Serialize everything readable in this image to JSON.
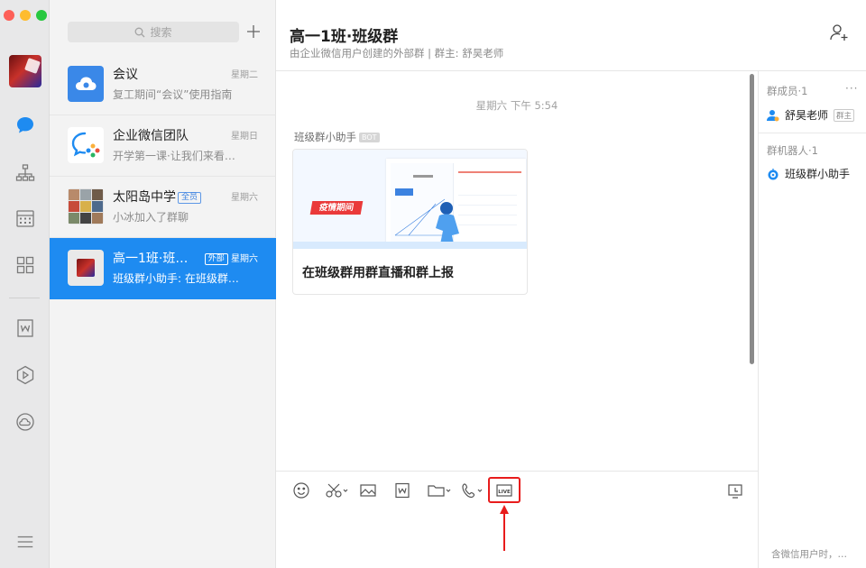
{
  "window": {
    "traffic_lights": [
      "close",
      "minimize",
      "maximize"
    ]
  },
  "rail": {
    "items": [
      {
        "icon": "chat-icon",
        "active": true
      },
      {
        "icon": "contacts-org-icon"
      },
      {
        "icon": "calendar-icon"
      },
      {
        "icon": "apps-grid-icon"
      },
      {
        "icon": "document-w-icon"
      },
      {
        "icon": "play-hexagon-icon"
      },
      {
        "icon": "cloud-disk-icon"
      },
      {
        "icon": "menu-icon"
      }
    ]
  },
  "sidebar": {
    "search_placeholder": "搜索",
    "conversations": [
      {
        "name": "会议",
        "preview": "复工期间“会议”使用指南",
        "time": "星期二",
        "tag": ""
      },
      {
        "name": "企业微信团队",
        "preview": "开学第一课·让我们来看…",
        "time": "星期日",
        "tag": ""
      },
      {
        "name": "太阳岛中学",
        "preview": "小冰加入了群聊",
        "time": "星期六",
        "tag": "全员"
      },
      {
        "name": "高一1班·班…",
        "preview": "班级群小助手: 在班级群…",
        "time": "星期六",
        "tag": "外部",
        "active": true
      }
    ]
  },
  "chat": {
    "title": "高一1班·班级群",
    "subtitle": "由企业微信用户创建的外部群 | 群主: 舒昊老师",
    "timestamp": "星期六 下午 5:54",
    "sender": "班级群小助手",
    "sender_tag": "BOT",
    "card": {
      "ribbon": "疫情期间",
      "title": "在班级群用群直播和群上报"
    }
  },
  "toolbar": {
    "tools": [
      "emoji-icon",
      "scissors-icon",
      "image-icon",
      "word-doc-icon",
      "folder-icon",
      "phone-icon",
      "live-icon",
      "history-icon"
    ],
    "live_label": "LIVE",
    "highlight_color": "#e81c1c"
  },
  "members_panel": {
    "members_title": "群成员·1",
    "more": "···",
    "owner_name": "舒昊老师",
    "owner_tag": "群主",
    "robots_title": "群机器人·1",
    "robot_name": "班级群小助手",
    "footer": "含微信用户时，…"
  },
  "colors": {
    "accent": "#1e8bf1",
    "tag_blue": "#3c82e0",
    "red": "#e81c1c"
  }
}
